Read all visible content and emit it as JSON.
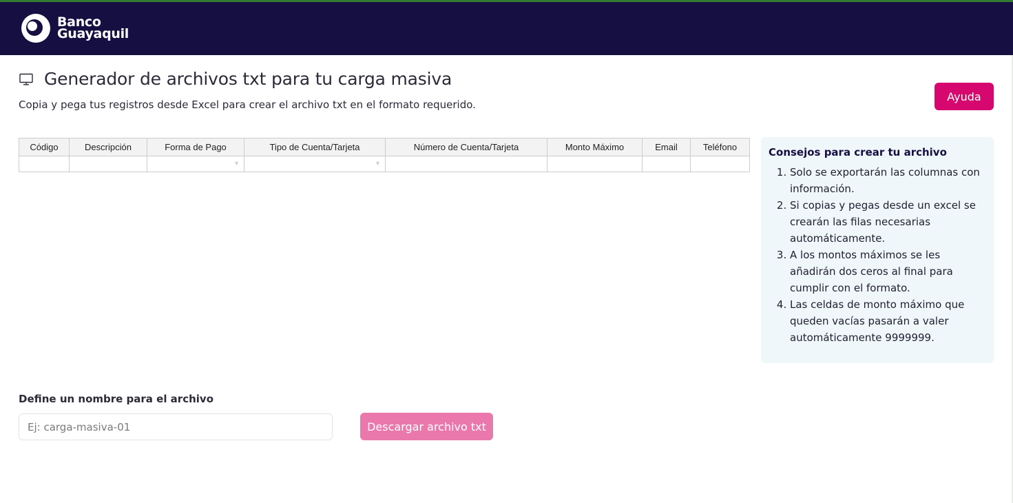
{
  "brand": {
    "name_line1": "Banco",
    "name_line2": "Guayaquil",
    "colors": {
      "header_bg": "#160f41",
      "accent": "#d6076f",
      "accent_disabled": "#ea78ad",
      "tips_bg": "#eff7fb"
    }
  },
  "page": {
    "icon": "monitor-icon",
    "title": "Generador de archivos txt para tu carga masiva",
    "subtitle": "Copia y pega tus registros desde Excel para crear el archivo txt en el formato requerido."
  },
  "help_button": {
    "label": "Ayuda"
  },
  "grid": {
    "columns": [
      "Código",
      "Descripción",
      "Forma de Pago",
      "Tipo de Cuenta/Tarjeta",
      "Número de Cuenta/Tarjeta",
      "Monto Máximo",
      "Email",
      "Teléfono"
    ],
    "dropdown_arrow": "▼"
  },
  "tips": {
    "title": "Consejos para crear tu archivo",
    "items": [
      "Solo se exportarán las columnas con información.",
      "Si copias y pegas desde un excel se crearán las filas necesarias automáticamente.",
      "A los montos máximos se les añadirán dos ceros al final para cumplir con el formato.",
      "Las celdas de monto máximo que queden vacías pasarán a valer automáticamente 9999999."
    ]
  },
  "file": {
    "label": "Define un nombre para el archivo",
    "placeholder": "Ej: carga-masiva-01",
    "value": "",
    "download_label": "Descargar archivo txt"
  }
}
